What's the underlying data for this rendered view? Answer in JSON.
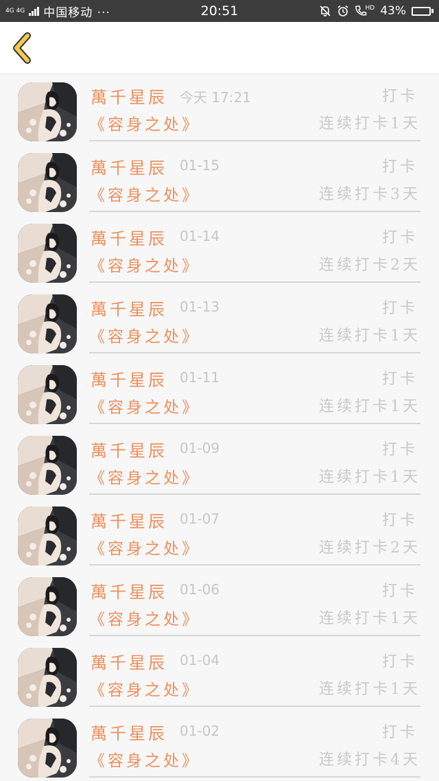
{
  "status_bar": {
    "network": "4G 4G",
    "carrier": "中国移动 ···",
    "time": "20:51",
    "hd": "HD",
    "battery_text": "43%",
    "battery_level": 0.43
  },
  "nav": {
    "back_icon": "chevron-left-icon",
    "accent": "#f2c94c"
  },
  "colors": {
    "name": "#ef8f5c",
    "muted": "#c9c9c9"
  },
  "entries": [
    {
      "name": "萬千星辰",
      "date": "今天 17:21",
      "action": "打卡",
      "book": "《容身之处》",
      "streak": "连续打卡1天"
    },
    {
      "name": "萬千星辰",
      "date": "01-15",
      "action": "打卡",
      "book": "《容身之处》",
      "streak": "连续打卡3天"
    },
    {
      "name": "萬千星辰",
      "date": "01-14",
      "action": "打卡",
      "book": "《容身之处》",
      "streak": "连续打卡2天"
    },
    {
      "name": "萬千星辰",
      "date": "01-13",
      "action": "打卡",
      "book": "《容身之处》",
      "streak": "连续打卡1天"
    },
    {
      "name": "萬千星辰",
      "date": "01-11",
      "action": "打卡",
      "book": "《容身之处》",
      "streak": "连续打卡1天"
    },
    {
      "name": "萬千星辰",
      "date": "01-09",
      "action": "打卡",
      "book": "《容身之处》",
      "streak": "连续打卡1天"
    },
    {
      "name": "萬千星辰",
      "date": "01-07",
      "action": "打卡",
      "book": "《容身之处》",
      "streak": "连续打卡2天"
    },
    {
      "name": "萬千星辰",
      "date": "01-06",
      "action": "打卡",
      "book": "《容身之处》",
      "streak": "连续打卡1天"
    },
    {
      "name": "萬千星辰",
      "date": "01-04",
      "action": "打卡",
      "book": "《容身之处》",
      "streak": "连续打卡1天"
    },
    {
      "name": "萬千星辰",
      "date": "01-02",
      "action": "打卡",
      "book": "《容身之处》",
      "streak": "连续打卡4天"
    }
  ]
}
